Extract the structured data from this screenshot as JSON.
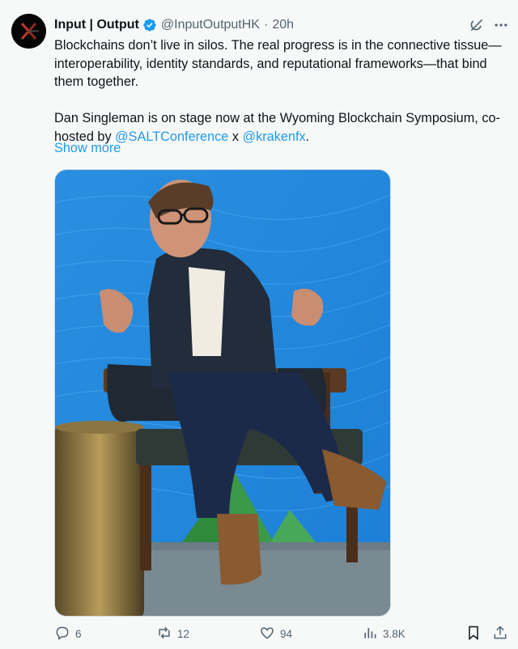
{
  "author": {
    "name": "Input | Output",
    "handle": "@InputOutputHK",
    "separator": "·",
    "time": "20h"
  },
  "text": {
    "p1": "Blockchains don’t live in silos. The real progress is in the connective tissue—interoperability, identity standards, and reputational frameworks—that bind them together.",
    "p2_prefix": "Dan Singleman is on stage now at the Wyoming Blockchain Symposium, co-hosted by ",
    "mention1": "@SALTConference",
    "p2_mid": " x ",
    "mention2": "@krakenfx",
    "p2_suffix": "."
  },
  "show_more": "Show more",
  "actions": {
    "replies": "6",
    "reposts": "12",
    "likes": "94",
    "views": "3.8K"
  },
  "colors": {
    "accent": "#1d9bf0",
    "secondary_text": "#536471",
    "background": "#f7f9f9"
  },
  "icons": {
    "verified": "verified-badge-icon",
    "grok": "grok-icon",
    "more": "more-icon",
    "reply": "reply-icon",
    "repost": "repost-icon",
    "like": "like-icon",
    "views": "views-icon",
    "bookmark": "bookmark-icon",
    "share": "share-icon"
  }
}
